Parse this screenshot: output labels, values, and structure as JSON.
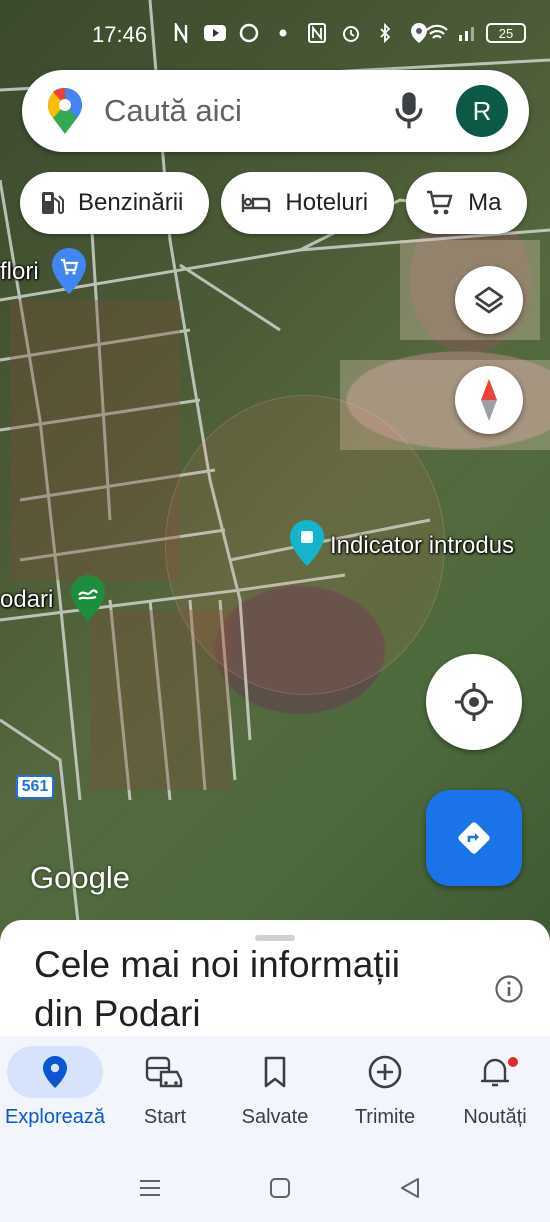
{
  "status_bar": {
    "time": "17:46",
    "battery": "25",
    "icons": [
      "n-notification-icon",
      "youtube-icon",
      "opera-icon",
      "dot-icon",
      "nfc-icon",
      "alarm-icon",
      "bluetooth-icon",
      "location-icon",
      "wifi-icon",
      "signal-icon"
    ]
  },
  "search": {
    "placeholder": "Caută aici",
    "avatar_letter": "R"
  },
  "chips": [
    {
      "label": "Benzinării",
      "icon": "gas-station-icon"
    },
    {
      "label": "Hoteluri",
      "icon": "bed-icon"
    },
    {
      "label": "Ma",
      "icon": "shopping-cart-icon"
    }
  ],
  "map": {
    "labels": {
      "flori": "flori",
      "podari": "odari",
      "dropped_pin": "Indicator introdus",
      "road_number": "561",
      "attribution": "Google"
    }
  },
  "sheet": {
    "title": "Cele mai noi informații din Podari"
  },
  "bottom_nav": {
    "items": [
      {
        "label": "Explorează",
        "icon": "location-pin-icon",
        "active": true
      },
      {
        "label": "Start",
        "icon": "commute-icon",
        "active": false
      },
      {
        "label": "Salvate",
        "icon": "bookmark-icon",
        "active": false
      },
      {
        "label": "Trimite",
        "icon": "add-circle-icon",
        "active": false
      },
      {
        "label": "Noutăți",
        "icon": "bell-icon",
        "active": false
      }
    ]
  },
  "colors": {
    "accent": "#1a73e8",
    "avatar_bg": "#0b5a45",
    "active_nav": "#0b57d0",
    "nav_bg": "#f2f5fb"
  }
}
